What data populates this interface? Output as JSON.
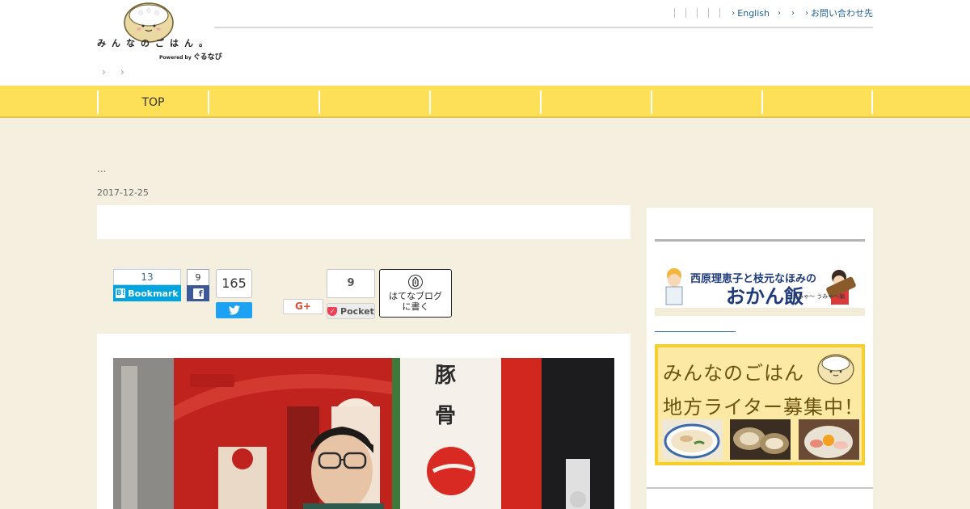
{
  "header": {
    "logo_text": "みんなのごはん。",
    "logo_powered": "Powered by",
    "logo_brand": "ぐるなび",
    "top_links": [
      "English",
      "",
      "",
      "お問い合わせ先"
    ],
    "breadcrumb": [
      "",
      ""
    ]
  },
  "nav": {
    "items": [
      "TOP",
      "",
      "",
      "",
      "",
      "",
      ""
    ]
  },
  "article": {
    "excerpt": "...",
    "date": "2017-12-25"
  },
  "share": {
    "hatena_bookmark_count": "13",
    "hatena_bookmark_label": "Bookmark",
    "facebook_count": "9",
    "twitter_count": "165",
    "google_plus_label": "G+",
    "pocket_count": "9",
    "pocket_label": "Pocket",
    "hatena_blog_label": "はてなブログ\nに書く"
  },
  "sidebar": {
    "okan_banner_title": "西原理恵子と枝元なほみの",
    "okan_banner_main": "おかん飯",
    "okan_banner_sub": "うみゃ〜 うみゃ〜編",
    "writer_banner_line1": "みんなのごはん",
    "writer_banner_line2": "地方ライター募集中！"
  },
  "colors": {
    "background": "#f4efdf",
    "nav_yellow": "#fde057",
    "hatena_blue": "#00a4de",
    "facebook_blue": "#3b5998",
    "twitter_blue": "#1da1f2",
    "pocket_red": "#ef4056"
  }
}
